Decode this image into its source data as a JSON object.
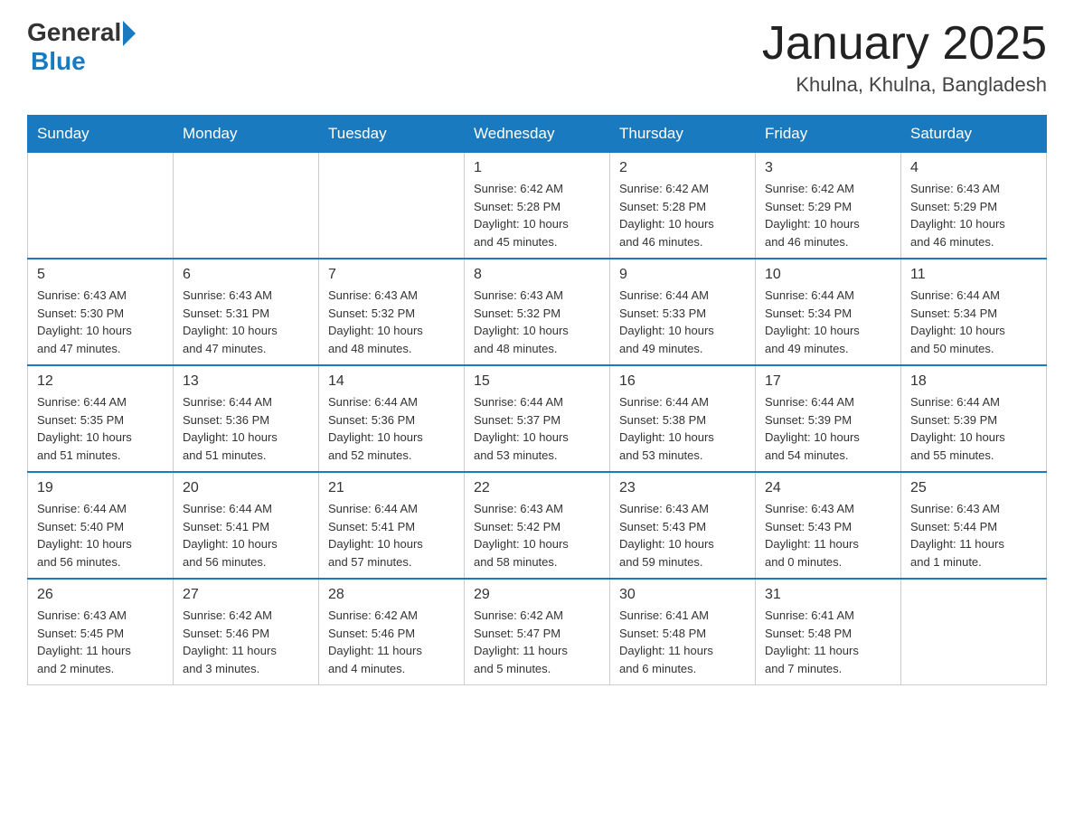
{
  "header": {
    "logo_general": "General",
    "logo_blue": "Blue",
    "title": "January 2025",
    "subtitle": "Khulna, Khulna, Bangladesh"
  },
  "days_of_week": [
    "Sunday",
    "Monday",
    "Tuesday",
    "Wednesday",
    "Thursday",
    "Friday",
    "Saturday"
  ],
  "weeks": [
    [
      {
        "day": "",
        "info": ""
      },
      {
        "day": "",
        "info": ""
      },
      {
        "day": "",
        "info": ""
      },
      {
        "day": "1",
        "info": "Sunrise: 6:42 AM\nSunset: 5:28 PM\nDaylight: 10 hours\nand 45 minutes."
      },
      {
        "day": "2",
        "info": "Sunrise: 6:42 AM\nSunset: 5:28 PM\nDaylight: 10 hours\nand 46 minutes."
      },
      {
        "day": "3",
        "info": "Sunrise: 6:42 AM\nSunset: 5:29 PM\nDaylight: 10 hours\nand 46 minutes."
      },
      {
        "day": "4",
        "info": "Sunrise: 6:43 AM\nSunset: 5:29 PM\nDaylight: 10 hours\nand 46 minutes."
      }
    ],
    [
      {
        "day": "5",
        "info": "Sunrise: 6:43 AM\nSunset: 5:30 PM\nDaylight: 10 hours\nand 47 minutes."
      },
      {
        "day": "6",
        "info": "Sunrise: 6:43 AM\nSunset: 5:31 PM\nDaylight: 10 hours\nand 47 minutes."
      },
      {
        "day": "7",
        "info": "Sunrise: 6:43 AM\nSunset: 5:32 PM\nDaylight: 10 hours\nand 48 minutes."
      },
      {
        "day": "8",
        "info": "Sunrise: 6:43 AM\nSunset: 5:32 PM\nDaylight: 10 hours\nand 48 minutes."
      },
      {
        "day": "9",
        "info": "Sunrise: 6:44 AM\nSunset: 5:33 PM\nDaylight: 10 hours\nand 49 minutes."
      },
      {
        "day": "10",
        "info": "Sunrise: 6:44 AM\nSunset: 5:34 PM\nDaylight: 10 hours\nand 49 minutes."
      },
      {
        "day": "11",
        "info": "Sunrise: 6:44 AM\nSunset: 5:34 PM\nDaylight: 10 hours\nand 50 minutes."
      }
    ],
    [
      {
        "day": "12",
        "info": "Sunrise: 6:44 AM\nSunset: 5:35 PM\nDaylight: 10 hours\nand 51 minutes."
      },
      {
        "day": "13",
        "info": "Sunrise: 6:44 AM\nSunset: 5:36 PM\nDaylight: 10 hours\nand 51 minutes."
      },
      {
        "day": "14",
        "info": "Sunrise: 6:44 AM\nSunset: 5:36 PM\nDaylight: 10 hours\nand 52 minutes."
      },
      {
        "day": "15",
        "info": "Sunrise: 6:44 AM\nSunset: 5:37 PM\nDaylight: 10 hours\nand 53 minutes."
      },
      {
        "day": "16",
        "info": "Sunrise: 6:44 AM\nSunset: 5:38 PM\nDaylight: 10 hours\nand 53 minutes."
      },
      {
        "day": "17",
        "info": "Sunrise: 6:44 AM\nSunset: 5:39 PM\nDaylight: 10 hours\nand 54 minutes."
      },
      {
        "day": "18",
        "info": "Sunrise: 6:44 AM\nSunset: 5:39 PM\nDaylight: 10 hours\nand 55 minutes."
      }
    ],
    [
      {
        "day": "19",
        "info": "Sunrise: 6:44 AM\nSunset: 5:40 PM\nDaylight: 10 hours\nand 56 minutes."
      },
      {
        "day": "20",
        "info": "Sunrise: 6:44 AM\nSunset: 5:41 PM\nDaylight: 10 hours\nand 56 minutes."
      },
      {
        "day": "21",
        "info": "Sunrise: 6:44 AM\nSunset: 5:41 PM\nDaylight: 10 hours\nand 57 minutes."
      },
      {
        "day": "22",
        "info": "Sunrise: 6:43 AM\nSunset: 5:42 PM\nDaylight: 10 hours\nand 58 minutes."
      },
      {
        "day": "23",
        "info": "Sunrise: 6:43 AM\nSunset: 5:43 PM\nDaylight: 10 hours\nand 59 minutes."
      },
      {
        "day": "24",
        "info": "Sunrise: 6:43 AM\nSunset: 5:43 PM\nDaylight: 11 hours\nand 0 minutes."
      },
      {
        "day": "25",
        "info": "Sunrise: 6:43 AM\nSunset: 5:44 PM\nDaylight: 11 hours\nand 1 minute."
      }
    ],
    [
      {
        "day": "26",
        "info": "Sunrise: 6:43 AM\nSunset: 5:45 PM\nDaylight: 11 hours\nand 2 minutes."
      },
      {
        "day": "27",
        "info": "Sunrise: 6:42 AM\nSunset: 5:46 PM\nDaylight: 11 hours\nand 3 minutes."
      },
      {
        "day": "28",
        "info": "Sunrise: 6:42 AM\nSunset: 5:46 PM\nDaylight: 11 hours\nand 4 minutes."
      },
      {
        "day": "29",
        "info": "Sunrise: 6:42 AM\nSunset: 5:47 PM\nDaylight: 11 hours\nand 5 minutes."
      },
      {
        "day": "30",
        "info": "Sunrise: 6:41 AM\nSunset: 5:48 PM\nDaylight: 11 hours\nand 6 minutes."
      },
      {
        "day": "31",
        "info": "Sunrise: 6:41 AM\nSunset: 5:48 PM\nDaylight: 11 hours\nand 7 minutes."
      },
      {
        "day": "",
        "info": ""
      }
    ]
  ]
}
